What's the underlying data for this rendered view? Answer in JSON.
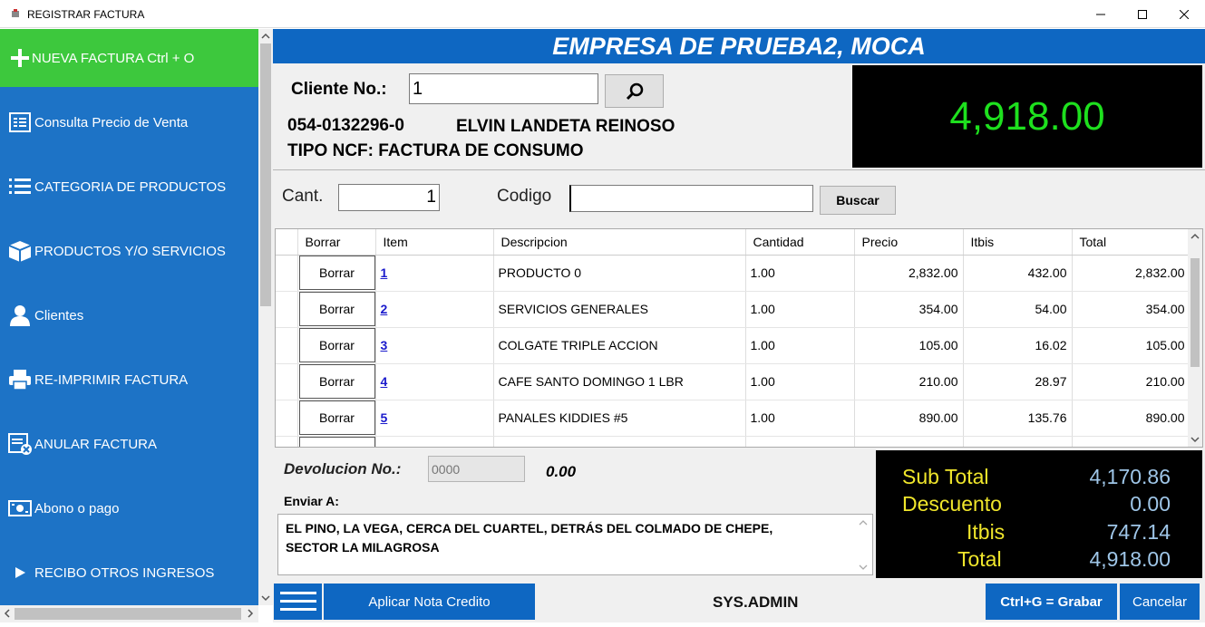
{
  "window": {
    "title": "REGISTRAR FACTURA"
  },
  "sidebar": {
    "new_invoice": "NUEVA FACTURA   Ctrl + O",
    "items": [
      {
        "label": "Consulta Precio de Venta",
        "icon": "price-list-icon"
      },
      {
        "label": "CATEGORIA DE PRODUCTOS",
        "icon": "list-icon"
      },
      {
        "label": "PRODUCTOS Y/O SERVICIOS",
        "icon": "box-icon"
      },
      {
        "label": "Clientes",
        "icon": "user-icon"
      },
      {
        "label": "RE-IMPRIMIR FACTURA",
        "icon": "printer-icon"
      },
      {
        "label": "ANULAR FACTURA",
        "icon": "cancel-invoice-icon"
      },
      {
        "label": "Abono o pago",
        "icon": "money-icon"
      },
      {
        "label": "RECIBO OTROS INGRESOS",
        "icon": "play-icon"
      }
    ]
  },
  "header": {
    "company": "EMPRESA DE PRUEBA2, MOCA"
  },
  "customer": {
    "label": "Cliente No.:",
    "number": "1",
    "rnc": "054-0132296-0",
    "name": "ELVIN LANDETA REINOSO",
    "ncf_type": "TIPO NCF: FACTURA DE CONSUMO"
  },
  "big_total": "4,918.00",
  "entry": {
    "qty_label": "Cant.",
    "qty_value": "1",
    "code_label": "Codigo",
    "code_value": "",
    "search_button": "Buscar"
  },
  "grid": {
    "columns": [
      "Borrar",
      "Item",
      "Descripcion",
      "Cantidad",
      "Precio",
      "Itbis",
      "Total"
    ],
    "delete_label": "Borrar",
    "rows": [
      {
        "item": "1",
        "desc": "PRODUCTO 0",
        "qty": "1.00",
        "price": "2,832.00",
        "itbis": "432.00",
        "total": "2,832.00"
      },
      {
        "item": "2",
        "desc": "SERVICIOS GENERALES",
        "qty": "1.00",
        "price": "354.00",
        "itbis": "54.00",
        "total": "354.00"
      },
      {
        "item": "3",
        "desc": "COLGATE TRIPLE ACCION",
        "qty": "1.00",
        "price": "105.00",
        "itbis": "16.02",
        "total": "105.00"
      },
      {
        "item": "4",
        "desc": "CAFE SANTO DOMINGO 1 LBR",
        "qty": "1.00",
        "price": "210.00",
        "itbis": "28.97",
        "total": "210.00"
      },
      {
        "item": "5",
        "desc": "PANALES KIDDIES #5",
        "qty": "1.00",
        "price": "890.00",
        "itbis": "135.76",
        "total": "890.00"
      }
    ]
  },
  "devolucion": {
    "label": "Devolucion No.:",
    "placeholder": "0000",
    "amount": "0.00"
  },
  "enviar": {
    "label": "Enviar A:",
    "address": "EL PINO, LA VEGA, CERCA DEL CUARTEL, DETRÁS DEL COLMADO DE CHEPE, SECTOR LA MILAGROSA"
  },
  "totals": {
    "subtotal_label": "Sub Total",
    "subtotal": "4,170.86",
    "discount_label": "Descuento",
    "discount": "0.00",
    "itbis_label": "Itbis",
    "itbis": "747.14",
    "total_label": "Total",
    "total": "4,918.00"
  },
  "footer": {
    "apply_credit": "Aplicar Nota Credito",
    "user": "SYS.ADMIN",
    "save": "Ctrl+G = Grabar",
    "cancel": "Cancelar"
  },
  "colors": {
    "sidebar": "#1d73c6",
    "new_button": "#3dc83d",
    "header": "#0e67c2",
    "total_green": "#1ee01e",
    "totals_label": "#f0e62b",
    "totals_value": "#9fc6e8"
  }
}
